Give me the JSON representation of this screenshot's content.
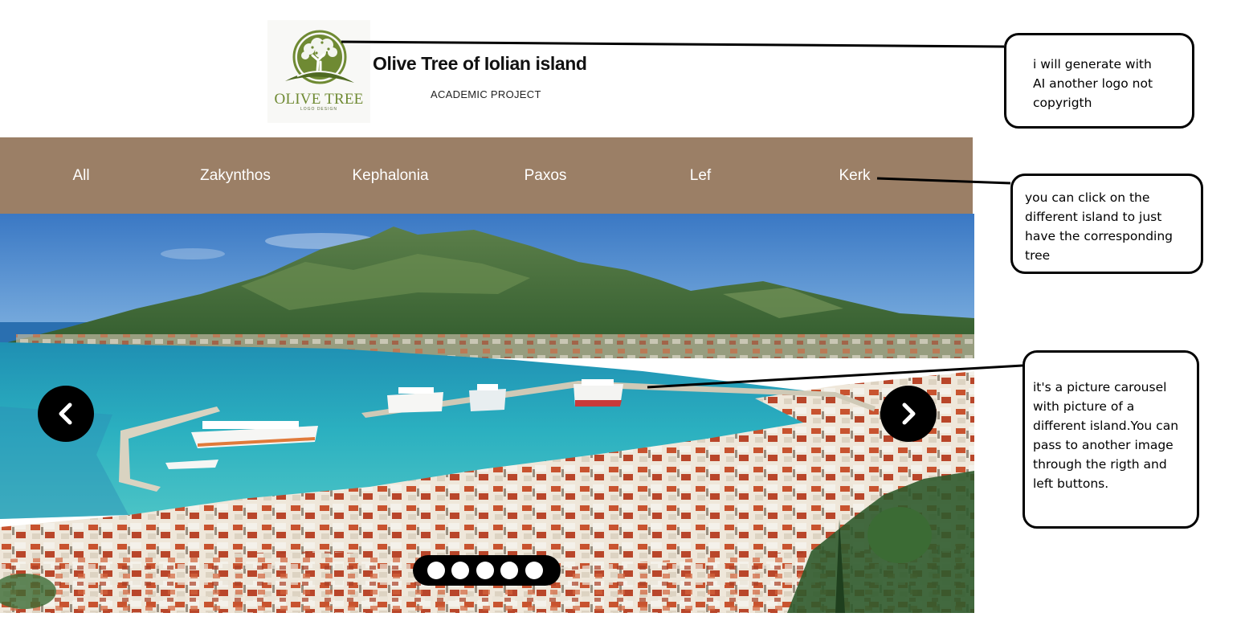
{
  "header": {
    "logo": {
      "brand_text": "OLIVE TREE",
      "sub_text": "LOGO DESIGN",
      "icon": "olive-tree-icon",
      "colors": {
        "green": "#6f8a33",
        "dark_green": "#4f6a22"
      }
    },
    "title": "Olive Tree of Iolian island",
    "subtitle": "ACADEMIC PROJECT"
  },
  "nav": {
    "background": "#9b7f66",
    "items": [
      {
        "label": "All"
      },
      {
        "label": "Zakynthos"
      },
      {
        "label": "Kephalonia"
      },
      {
        "label": "Paxos"
      },
      {
        "label": "Lef"
      },
      {
        "label": "Kerk"
      }
    ]
  },
  "carousel": {
    "image_subject": "island harbour town view",
    "prev_icon": "chevron-left-icon",
    "next_icon": "chevron-right-icon",
    "slide_count": 5
  },
  "annotations": {
    "logo_note": [
      "i will generate with",
      "AI another logo not",
      "copyrigth"
    ],
    "nav_note": [
      "you can click on the",
      "different island to just",
      "have the corresponding",
      "tree"
    ],
    "carousel_note": [
      "it's a picture carousel",
      "with picture of a",
      "different island.You can",
      "pass to another image",
      "through the rigth and",
      "left buttons."
    ]
  }
}
